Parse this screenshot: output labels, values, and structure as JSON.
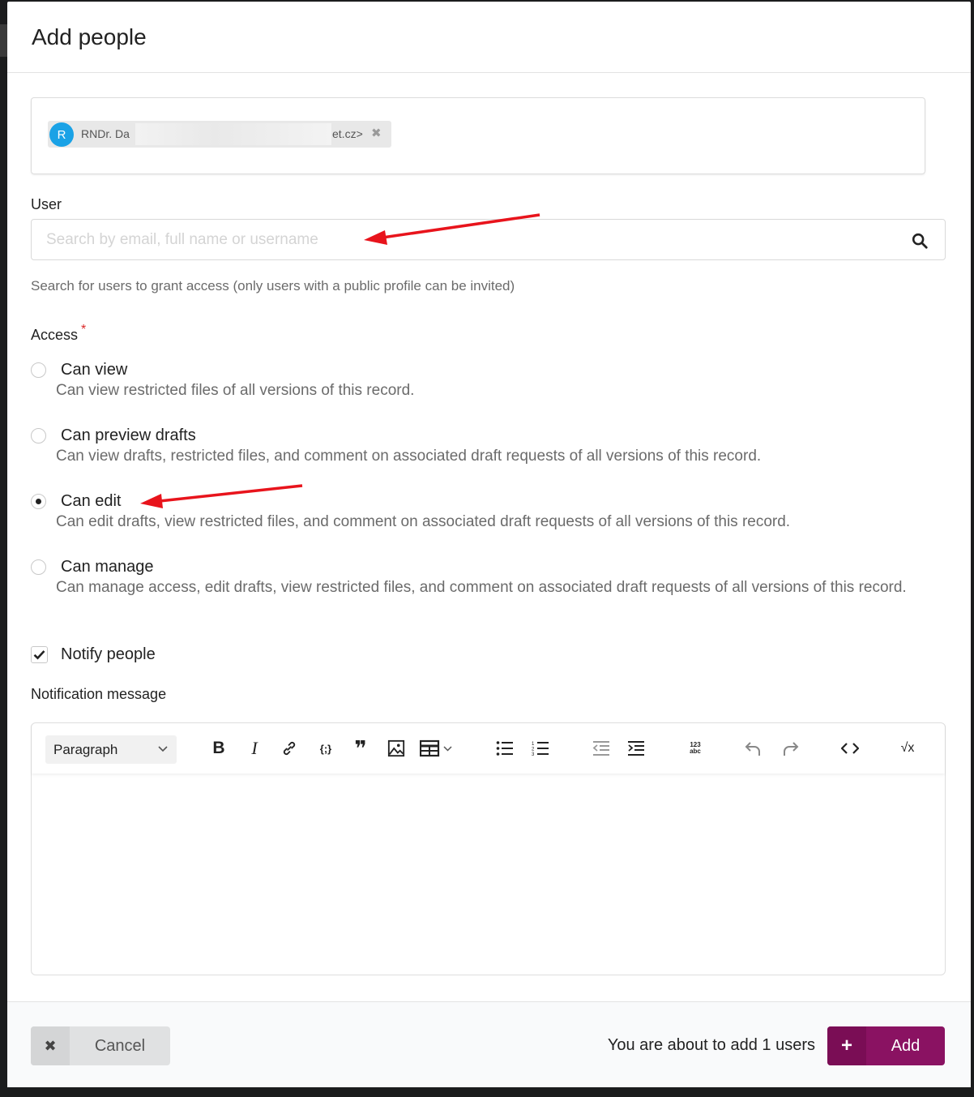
{
  "dialog": {
    "title": "Add people"
  },
  "selected_users": [
    {
      "avatar_letter": "R",
      "name_visible_start": "RNDr. Da",
      "name_visible_end": "et.cz>",
      "remove_glyph": "✖"
    }
  ],
  "user_field": {
    "label": "User",
    "placeholder": "Search by email, full name or username",
    "value": "",
    "help": "Search for users to grant access (only users with a public profile can be invited)",
    "icon": "search-icon"
  },
  "access": {
    "label": "Access",
    "required_mark": "*",
    "selected": "can-edit",
    "options": [
      {
        "id": "can-view",
        "label": "Can view",
        "description": "Can view restricted files of all versions of this record."
      },
      {
        "id": "can-preview-drafts",
        "label": "Can preview drafts",
        "description": "Can view drafts, restricted files, and comment on associated draft requests of all versions of this record."
      },
      {
        "id": "can-edit",
        "label": "Can edit",
        "description": "Can edit drafts, view restricted files, and comment on associated draft requests of all versions of this record."
      },
      {
        "id": "can-manage",
        "label": "Can manage",
        "description": "Can manage access, edit drafts, view restricted files, and comment on associated draft requests of all versions of this record."
      }
    ]
  },
  "notify": {
    "label": "Notify people",
    "checked": true
  },
  "notification_message": {
    "label": "Notification message",
    "block_format": "Paragraph",
    "toolbar": [
      "bold-icon",
      "italic-icon",
      "link-icon",
      "code-block-icon",
      "blockquote-icon",
      "image-icon",
      "table-icon",
      "bulleted-list-icon",
      "numbered-list-icon",
      "outdent-icon",
      "indent-icon",
      "text-part-language-icon",
      "undo-icon",
      "redo-icon",
      "source-icon",
      "math-icon"
    ],
    "toolbar_text": {
      "bold": "B",
      "italic": "I",
      "code_block": "{;}",
      "blockquote": "❞",
      "math": "√x",
      "text_part_language": "123 abc"
    }
  },
  "footer": {
    "cancel_label": "Cancel",
    "cancel_icon": "✖",
    "summary": "You are about to add 1 users",
    "add_label": "Add",
    "add_icon": "+"
  },
  "colors": {
    "primary": "#8a1262",
    "avatar": "#1aa2e6",
    "required": "#db2828",
    "annotation_arrow": "#e8141c"
  }
}
